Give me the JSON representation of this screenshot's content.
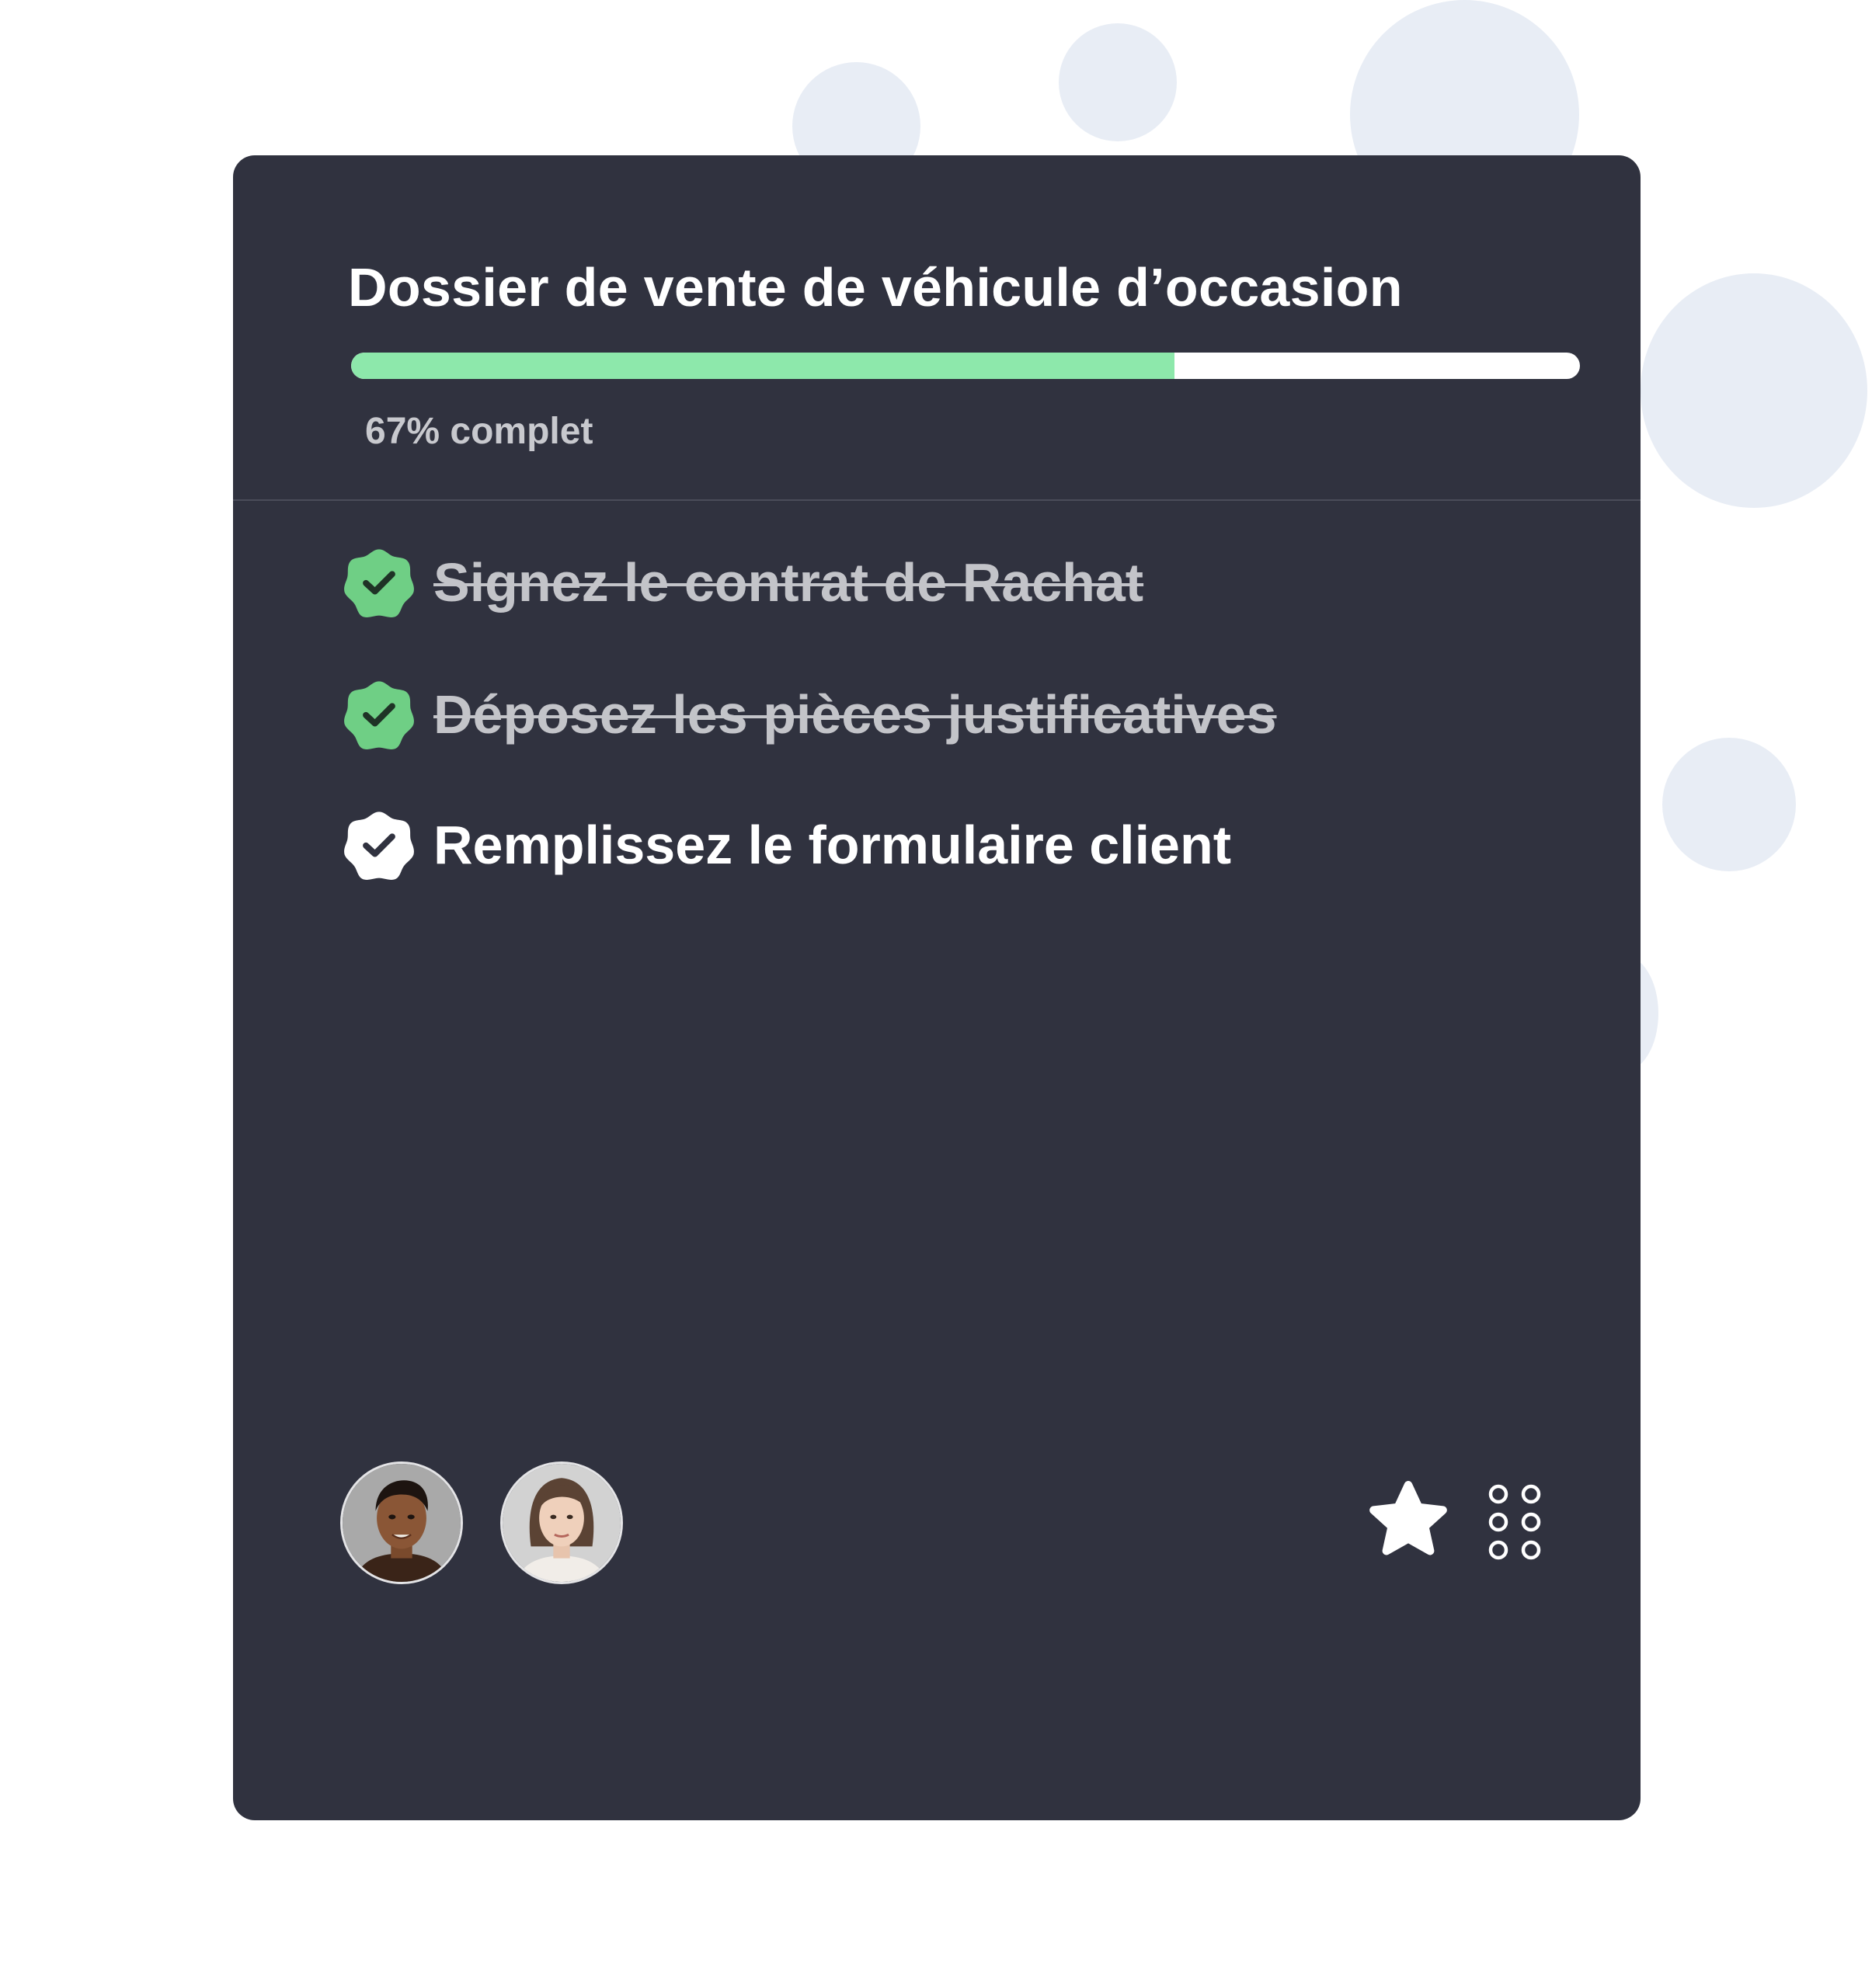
{
  "card": {
    "title": "Dossier de vente de véhicule d’occasion",
    "progress": {
      "percent": 67,
      "label": "67% complet",
      "fill_color": "#8de8ab",
      "track_color": "#ffffff"
    },
    "tasks": [
      {
        "label": "Signez le contrat de Rachat",
        "done": true,
        "icon": "verified-badge-icon"
      },
      {
        "label": "Déposez les pièces justificatives",
        "done": true,
        "icon": "verified-badge-icon"
      },
      {
        "label": "Remplissez le formulaire client",
        "done": false,
        "icon": "verified-badge-icon"
      }
    ],
    "footer": {
      "avatars": [
        "avatar",
        "avatar"
      ],
      "actions": [
        "star-icon",
        "grid-dots-icon"
      ]
    }
  },
  "colors": {
    "card_background": "#30323f",
    "done_badge": "#6fcf85",
    "pending_badge": "#ffffff",
    "done_text": "#c3c4c9",
    "pending_text": "#ffffff"
  }
}
